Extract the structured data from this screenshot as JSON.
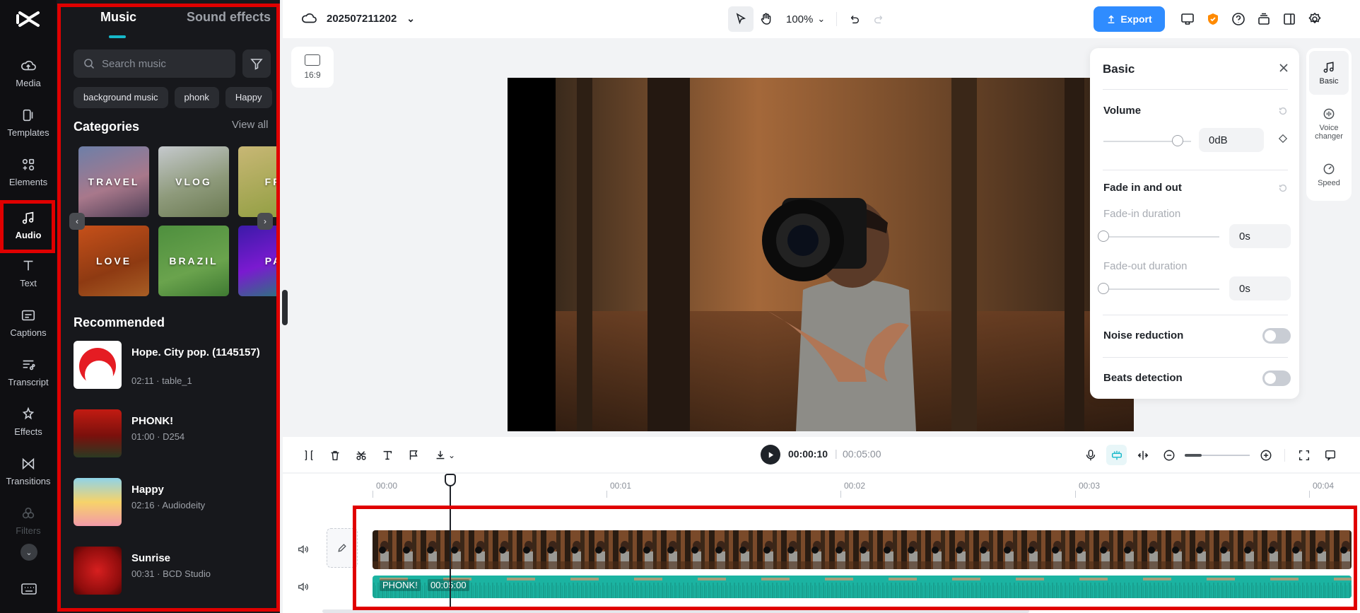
{
  "rail": {
    "items": [
      {
        "label": "Media",
        "icon": "media-icon"
      },
      {
        "label": "Templates",
        "icon": "templates-icon"
      },
      {
        "label": "Elements",
        "icon": "elements-icon"
      },
      {
        "label": "Audio",
        "icon": "audio-icon",
        "active": true
      },
      {
        "label": "Text",
        "icon": "text-icon"
      },
      {
        "label": "Captions",
        "icon": "captions-icon"
      },
      {
        "label": "Transcript",
        "icon": "transcript-icon"
      },
      {
        "label": "Effects",
        "icon": "effects-icon"
      },
      {
        "label": "Transitions",
        "icon": "transitions-icon"
      },
      {
        "label": "Filters",
        "icon": "filters-icon"
      }
    ]
  },
  "panel": {
    "tabs": {
      "music": "Music",
      "sound_effects": "Sound effects"
    },
    "search_placeholder": "Search music",
    "chips": [
      "background music",
      "phonk",
      "Happy"
    ],
    "categories_title": "Categories",
    "view_all": "View all",
    "categories": [
      "TRAVEL",
      "VLOG",
      "FR",
      "LOVE",
      "BRAZIL",
      "PA"
    ],
    "recommended_title": "Recommended",
    "recommended": [
      {
        "title": "Hope. City pop. (1145157)",
        "meta": "02:11 · table_1"
      },
      {
        "title": "PHONK!",
        "meta": "01:00 · D254"
      },
      {
        "title": "Happy",
        "meta": "02:16 · Audiodeity"
      },
      {
        "title": "Sunrise",
        "meta": "00:31 · BCD Studio"
      }
    ]
  },
  "topbar": {
    "project_name": "202507211202",
    "zoom": "100%",
    "export_label": "Export"
  },
  "preview": {
    "ratio": "16:9"
  },
  "basic": {
    "title": "Basic",
    "volume_label": "Volume",
    "volume_value": "0dB",
    "volume_level": 0.85,
    "fade_label": "Fade in and out",
    "fade_in_label": "Fade-in duration",
    "fade_in_value": "0s",
    "fade_out_label": "Fade-out duration",
    "fade_out_value": "0s",
    "noise_label": "Noise reduction",
    "beats_label": "Beats detection"
  },
  "right_tabs": [
    {
      "label": "Basic",
      "icon": "music-note-icon"
    },
    {
      "label": "Voice changer",
      "icon": "voice-changer-icon"
    },
    {
      "label": "Speed",
      "icon": "speed-icon"
    }
  ],
  "timeline": {
    "current_time": "00:00:10",
    "total_time": "00:05:00",
    "ruler": [
      "00:00",
      "00:01",
      "00:02",
      "00:03",
      "00:04"
    ],
    "audio_clip_name": "PHONK!",
    "audio_clip_duration": "00:05:00"
  },
  "colors": {
    "accent": "#16b8c9",
    "export": "#2f8cff",
    "audio_clip": "#1bb3a1",
    "highlight": "#e00000"
  }
}
